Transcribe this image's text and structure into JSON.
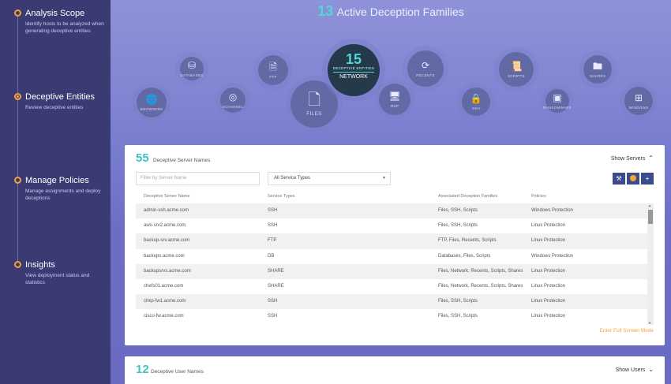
{
  "sidebar": {
    "steps": [
      {
        "title": "Analysis Scope",
        "desc": "Identify hosts to be analyzed when generating deceptive entities"
      },
      {
        "title": "Deceptive Entities",
        "desc": "Review deceptive entities"
      },
      {
        "title": "Manage Policies",
        "desc": "Manage assignments and deploy deceptions"
      },
      {
        "title": "Insights",
        "desc": "View deployment status and statistics"
      }
    ]
  },
  "header": {
    "count": "13",
    "title": "Active Deception Families"
  },
  "families": [
    {
      "label": "DATABASES",
      "icon": "database-icon"
    },
    {
      "label": "FTP",
      "icon": "ftp-icon"
    },
    {
      "label": "BROWSERS",
      "icon": "globe-icon"
    },
    {
      "label": "SCHANNEL",
      "icon": "schannel-icon"
    },
    {
      "label": "FILES",
      "icon": "file-icon"
    },
    {
      "label": "RDP",
      "icon": "monitor-icon"
    },
    {
      "label": "RECENTS",
      "icon": "history-icon"
    },
    {
      "label": "SSH",
      "icon": "lock-icon"
    },
    {
      "label": "SCRIPTS",
      "icon": "script-icon"
    },
    {
      "label": "RANSOMWARE",
      "icon": "ransomware-icon"
    },
    {
      "label": "SHARES",
      "icon": "folder-icon"
    },
    {
      "label": "WINDOWS",
      "icon": "windows-icon"
    }
  ],
  "center": {
    "count": "15",
    "subtitle": "DECEPTIVE ENTITIES",
    "label": "NETWORK"
  },
  "servers": {
    "count": "55",
    "title": "Deceptive Server Names",
    "show_label": "Show Servers",
    "filter_placeholder": "Filter by Server Name",
    "service_select": "All Service Types",
    "columns": [
      "Deceptive Server Name",
      "Service Types",
      "Associated Deception Families",
      "Policies"
    ],
    "rows": [
      [
        "admin-ssh.acme.com",
        "SSH",
        "Files, SSH, Scripts",
        "Windows Protection"
      ],
      [
        "aws-srv2.acme.com",
        "SSH",
        "Files, SSH, Scripts",
        "Linux Protection"
      ],
      [
        "backup-srv.acme.com",
        "FTP",
        "FTP, Files, Recents, Scripts",
        "Linux Protection"
      ],
      [
        "backups.acme.com",
        "DB",
        "Databases, Files, Scripts",
        "Windows Protection"
      ],
      [
        "backupsrvs.acme.com",
        "SHARE",
        "Files, Network, Recents, Scripts, Shares",
        "Linux Protection"
      ],
      [
        "chefs01.acme.com",
        "SHARE",
        "Files, Network, Recents, Scripts, Shares",
        "Linux Protection"
      ],
      [
        "chkp-fw1.acme.com",
        "SSH",
        "Files, SSH, Scripts",
        "Linux Protection"
      ],
      [
        "cisco-fw.acme.com",
        "SSH",
        "Files, SSH, Scripts",
        "Linux Protection"
      ]
    ],
    "fullscreen_label": "Enter Full Screen Mode"
  },
  "users": {
    "count": "12",
    "title": "Deceptive User Names",
    "show_label": "Show Users"
  }
}
